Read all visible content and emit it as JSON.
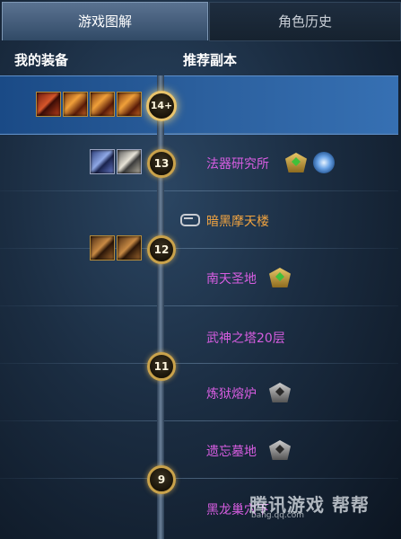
{
  "tabs": [
    {
      "label": "游戏图解",
      "active": true
    },
    {
      "label": "角色历史",
      "active": false
    }
  ],
  "headers": {
    "equipment": "我的装备",
    "dungeons": "推荐副本"
  },
  "levels": [
    {
      "label": "14+",
      "highlighted": true
    },
    {
      "label": "13"
    },
    {
      "label": "12"
    },
    {
      "label": "11"
    },
    {
      "label": "9"
    }
  ],
  "equipment_icons": {
    "level_14": [
      "weapon-red-icon",
      "ring-orange-icon",
      "amulet-orange-icon",
      "weapon-orange-icon"
    ],
    "level_13": [
      "scroll-blue-icon",
      "tome-silver-icon"
    ],
    "level_12": [
      "gauntlet-bronze-icon",
      "gauntlet-bronze-icon"
    ]
  },
  "dungeons": [
    {
      "name": "法器研究所",
      "color": "#d65de0",
      "drops": [
        "green-gem-icon",
        "blue-orb-icon"
      ]
    },
    {
      "name": "暗黑摩天楼",
      "color": "#f0a340",
      "prefix_icon": "link-icon",
      "drops": []
    },
    {
      "name": "南天圣地",
      "color": "#d65de0",
      "drops": [
        "green-gem-icon"
      ]
    },
    {
      "name": "武神之塔20层",
      "color": "#d65de0",
      "drops": []
    },
    {
      "name": "炼狱熔炉",
      "color": "#d65de0",
      "drops": [
        "gray-gem-icon"
      ]
    },
    {
      "name": "遗忘墓地",
      "color": "#d65de0",
      "drops": [
        "gray-gem-icon"
      ]
    },
    {
      "name": "黑龙巢穴下",
      "color": "#d65de0",
      "drops": []
    }
  ],
  "watermark": {
    "main": "腾讯游戏 帮帮",
    "sub": "bang.qq.com"
  }
}
